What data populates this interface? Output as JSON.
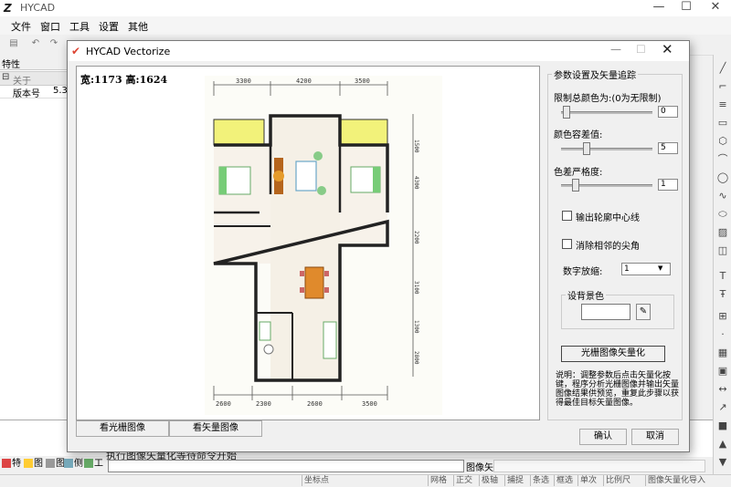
{
  "app": {
    "title": "HYCAD",
    "icon": "hycad-logo-icon"
  },
  "window_controls": {
    "minimize": "—",
    "maximize": "☐",
    "close": "✕"
  },
  "menu": {
    "items": [
      "文件",
      "窗口",
      "工具",
      "设置",
      "其他"
    ]
  },
  "properties": {
    "title": "特性",
    "group_toggle": "⊟",
    "group": "关于",
    "version_label": "版本号",
    "version_value": "5.3"
  },
  "dialog": {
    "title": "HYCAD Vectorize",
    "icon": "vectorize-icon",
    "preview": {
      "dims_label": "宽:1173 高:1624",
      "dims_top": [
        "3300",
        "4200",
        "3500"
      ],
      "dims_bottom": [
        "2600",
        "2300",
        "2600",
        "3500"
      ],
      "dims_right": [
        "1500",
        "4300",
        "2200",
        "3100",
        "1300",
        "2800"
      ]
    },
    "view_raster": "看光栅图像",
    "view_vector": "看矢量图像",
    "params": {
      "legend": "参数设置及矢量追踪",
      "color_limit_label": "限制总颜色为:(0为无限制)",
      "color_limit_value": "0",
      "color_tolerance_label": "颜色容差值:",
      "color_tolerance_value": "5",
      "color_gradient_label": "色差严格度:",
      "color_gradient_value": "1",
      "output_centerline_label": "输出轮廓中心线",
      "remove_spikes_label": "消除相邻的尖角",
      "zoom_label": "数字放缩:",
      "zoom_value": "1",
      "bg_legend": "设背景色",
      "bg_color": "#ffffff",
      "vectorize_button": "光栅图像矢量化",
      "description": "说明：调整参数后点击矢量化按键，程序分析光栅图像并输出矢量图像结果供预览，重复此步骤以获得最佳目标矢量图像。",
      "ok": "确认",
      "cancel": "取消"
    }
  },
  "command": {
    "history": "执行图像矢量化等待命令开始",
    "label": "图像矢...",
    "panel_tabs": [
      "特",
      "图",
      "图",
      "侧",
      "工"
    ]
  },
  "status": {
    "items": [
      "坐标点",
      "网格",
      "正交",
      "极轴",
      "捕捉",
      "条选",
      "框选",
      "单次",
      "比例尺",
      "图像矢量化导入"
    ]
  }
}
